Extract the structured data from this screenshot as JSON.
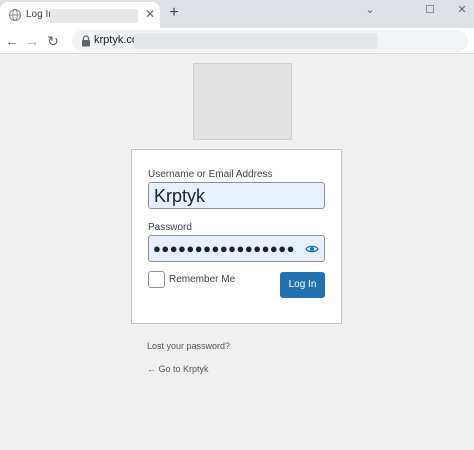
{
  "browser": {
    "tab": {
      "title": "Log In",
      "close_glyph": "✕"
    },
    "new_tab_glyph": "+",
    "window_controls": {
      "minimize": "⌄",
      "maximize": "☐",
      "close": "✕"
    },
    "nav": {
      "back": "←",
      "forward": "→",
      "reload": "↻"
    },
    "address": {
      "url": "krptyk.com"
    }
  },
  "login": {
    "username_label": "Username or Email Address",
    "username_value": "Krptyk",
    "password_label": "Password",
    "password_masked": "●●●●●●●●●●●●●●●●●",
    "remember_label": "Remember Me",
    "submit_label": "Log In"
  },
  "links": {
    "lost_password": "Lost your password?",
    "back_to_site": "← Go to Krptyk"
  },
  "colors": {
    "page_bg": "#f0f0f1",
    "primary_button": "#2271b1",
    "autofill_bg": "#e8f0fe"
  },
  "icons": [
    "globe-icon",
    "close-icon",
    "plus-icon",
    "lock-icon",
    "eye-icon",
    "back-arrow-icon",
    "forward-arrow-icon",
    "reload-icon"
  ]
}
